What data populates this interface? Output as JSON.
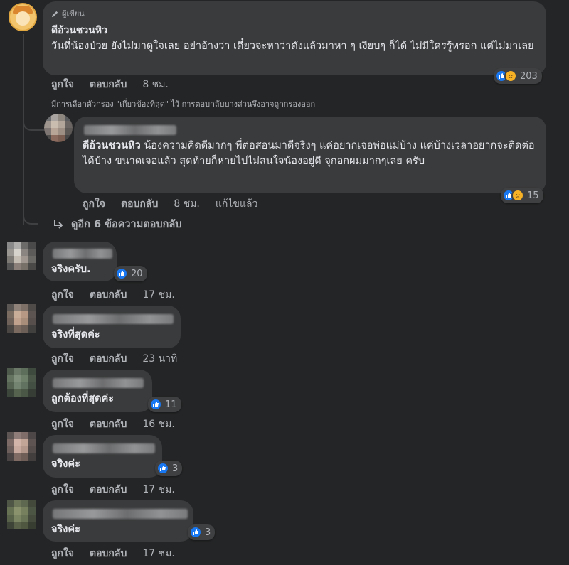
{
  "top_comment": {
    "author_badge": "ผู้เขียน",
    "name": "ดีอ้วนชวนหิว",
    "text": "วันที่น้องป่วย ยังไม่มาดูใจเลย อย่าอ้างว่า เดี๋ยวจะหาว่าดังแล้วมาหา ๆ เงียบๆ ก็ได้ ไม่มีใครรู้หรอก แต่ไม่มาเลย",
    "like_label": "ถูกใจ",
    "reply_label": "ตอบกลับ",
    "time": "8 ชม.",
    "reaction_count": "203"
  },
  "filter_note": "มีการเลือกตัวกรอง \"เกี่ยวข้องที่สุด\" ไว้ การตอบกลับบางส่วนจึงอาจถูกกรองออก",
  "reply": {
    "mention": "ดีอ้วนชวนหิว",
    "text": " น้องความคิดดีมากๆ พี่ต่อสอนมาดีจริงๆ แค่อยากเจอพ่อแม่บ้าง แค่บ้างเวลาอยากจะติดต่อได้บ้าง ขนาดเจอแล้ว สุดท้ายก็หายไปไม่สนใจน้องอยู่ดี จุกอกผมมากๆเลย ครับ",
    "like_label": "ถูกใจ",
    "reply_label": "ตอบกลับ",
    "time": "8 ชม.",
    "edited": "แก้ไขแล้ว",
    "reaction_count": "15"
  },
  "more_replies": "ดูอีก 6 ข้อความตอบกลับ",
  "comments": [
    {
      "text": "จริงครับ.",
      "like_label": "ถูกใจ",
      "reply_label": "ตอบกลับ",
      "time": "17 ชม.",
      "reaction_count": "20"
    },
    {
      "text": "จริงที่สุดค่ะ",
      "like_label": "ถูกใจ",
      "reply_label": "ตอบกลับ",
      "time": "23 นาที"
    },
    {
      "text": "ถูกต้องที่สุดค่ะ",
      "like_label": "ถูกใจ",
      "reply_label": "ตอบกลับ",
      "time": "16 ชม.",
      "reaction_count": "11"
    },
    {
      "text": "จริงค่ะ",
      "like_label": "ถูกใจ",
      "reply_label": "ตอบกลับ",
      "time": "17 ชม.",
      "reaction_count": "3"
    },
    {
      "text": "จริงค่ะ",
      "like_label": "ถูกใจ",
      "reply_label": "ตอบกลับ",
      "time": "17 ชม.",
      "reaction_count": "3"
    }
  ],
  "icons": {
    "like": "like-reaction-icon",
    "sad": "sad-reaction-icon",
    "pencil": "pencil-icon",
    "reply_arrow": "reply-arrow-icon"
  },
  "colors": {
    "background": "#242526",
    "bubble": "#3a3b3c",
    "like": "#1877f2",
    "sad": "#f7b125"
  }
}
